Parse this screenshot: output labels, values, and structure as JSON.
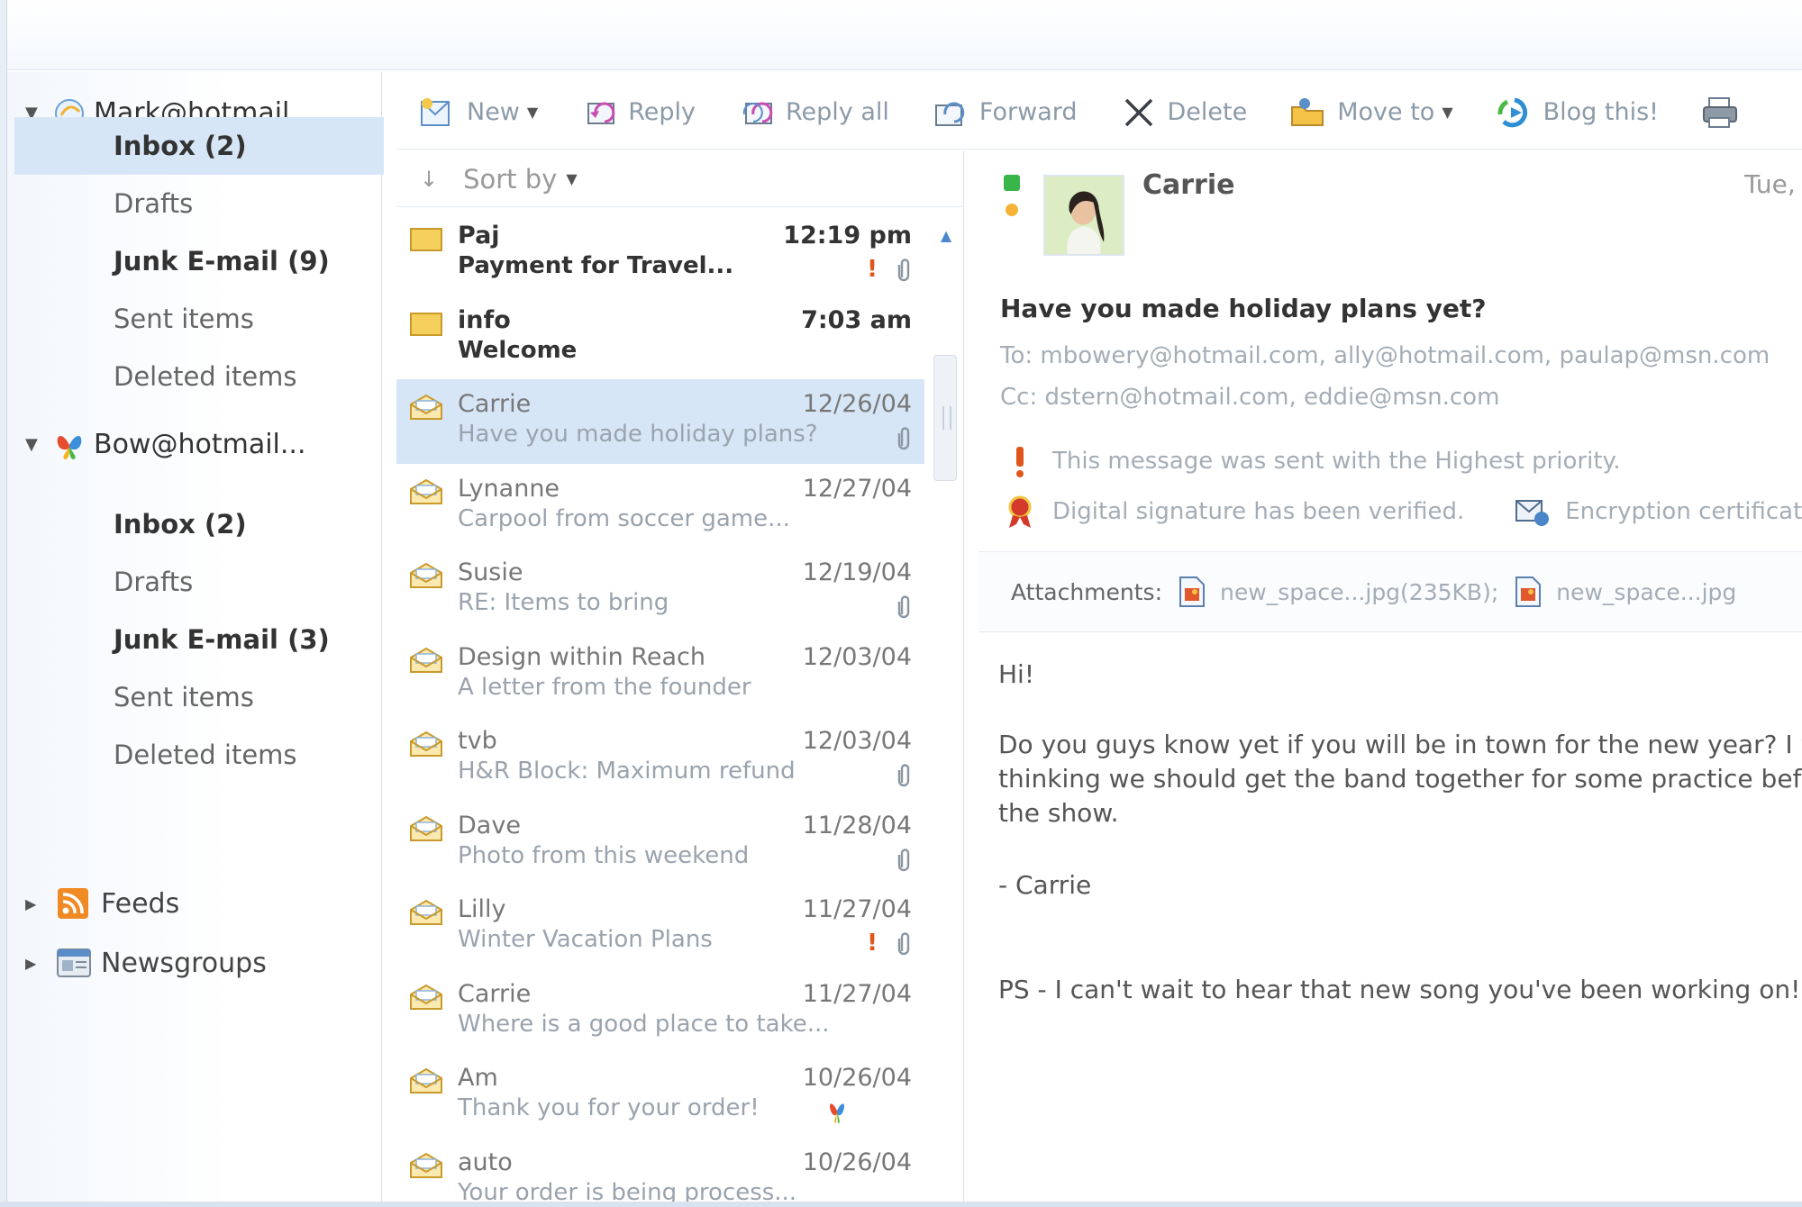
{
  "accounts": [
    {
      "name": "Mark@hotmail...",
      "folders": [
        {
          "label": "Inbox (2)",
          "bold": true,
          "selected": true
        },
        {
          "label": "Drafts",
          "bold": false
        },
        {
          "label": "Junk E-mail (9)",
          "bold": true
        },
        {
          "label": "Sent items",
          "bold": false
        },
        {
          "label": "Deleted items",
          "bold": false
        }
      ]
    },
    {
      "name": "Bow@hotmail...",
      "folders": [
        {
          "label": "Inbox (2)",
          "bold": true
        },
        {
          "label": "Drafts",
          "bold": false
        },
        {
          "label": "Junk E-mail (3)",
          "bold": true
        },
        {
          "label": "Sent items",
          "bold": false
        },
        {
          "label": "Deleted items",
          "bold": false
        }
      ]
    }
  ],
  "nodes": {
    "feeds": "Feeds",
    "newsgroups": "Newsgroups"
  },
  "toolbar": {
    "new": "New",
    "reply": "Reply",
    "reply_all": "Reply all",
    "forward": "Forward",
    "delete": "Delete",
    "move_to": "Move to",
    "blog_this": "Blog this!"
  },
  "list": {
    "sort_label": "Sort by",
    "messages": [
      {
        "from": "Paj",
        "subject": "Payment for Travel...",
        "date": "12:19 pm",
        "unread": true,
        "priority": true,
        "attachment": true
      },
      {
        "from": "info",
        "subject": "Welcome",
        "date": "7:03 am",
        "unread": true
      },
      {
        "from": "Carrie",
        "subject": "Have you made holiday plans?",
        "date": "12/26/04",
        "selected": true,
        "attachment": true
      },
      {
        "from": "Lynanne",
        "subject": "Carpool from soccer game...",
        "date": "12/27/04"
      },
      {
        "from": "Susie",
        "subject": "RE: Items to bring",
        "date": "12/19/04",
        "attachment": true
      },
      {
        "from": "Design within Reach",
        "subject": "A letter from the founder",
        "date": "12/03/04"
      },
      {
        "from": "tvb",
        "subject": "H&R Block: Maximum refund",
        "date": "12/03/04",
        "attachment": true
      },
      {
        "from": "Dave",
        "subject": "Photo from this weekend",
        "date": "11/28/04",
        "attachment": true
      },
      {
        "from": "Lilly",
        "subject": "Winter Vacation Plans",
        "date": "11/27/04",
        "priority": true,
        "attachment": true
      },
      {
        "from": "Carrie",
        "subject": "Where is a good place to take...",
        "date": "11/27/04"
      },
      {
        "from": "Am",
        "subject": "Thank you for your order!",
        "date": "10/26/04",
        "flag": true
      },
      {
        "from": "auto",
        "subject": "Your order is being process...",
        "date": "10/26/04"
      }
    ]
  },
  "reading": {
    "sender": "Carrie",
    "date": "Tue,",
    "subject": "Have you made holiday plans yet?",
    "to": "To: mbowery@hotmail.com, ally@hotmail.com, paulap@msn.com",
    "cc": "Cc: dstern@hotmail.com, eddie@msn.com",
    "priority_notice": "This message was sent with the Highest priority.",
    "signature_notice": "Digital signature has been verified.",
    "encryption_notice": "Encryption certificate",
    "attachments_label": "Attachments:",
    "attachment_1": "new_space...jpg(235KB);",
    "attachment_2": "new_space...jpg",
    "body": [
      "Hi!",
      "Do you guys know yet if you will be in town for the new year? I was",
      "thinking we should get the band together for some practice before",
      "the show.",
      "- Carrie",
      "PS - I can't wait to hear that new song you've been working on!"
    ]
  },
  "colors": {
    "selection": "#d6e6f6",
    "priority": "#e0561a",
    "presence_online": "#39b54a",
    "presence_away": "#f5b335"
  }
}
